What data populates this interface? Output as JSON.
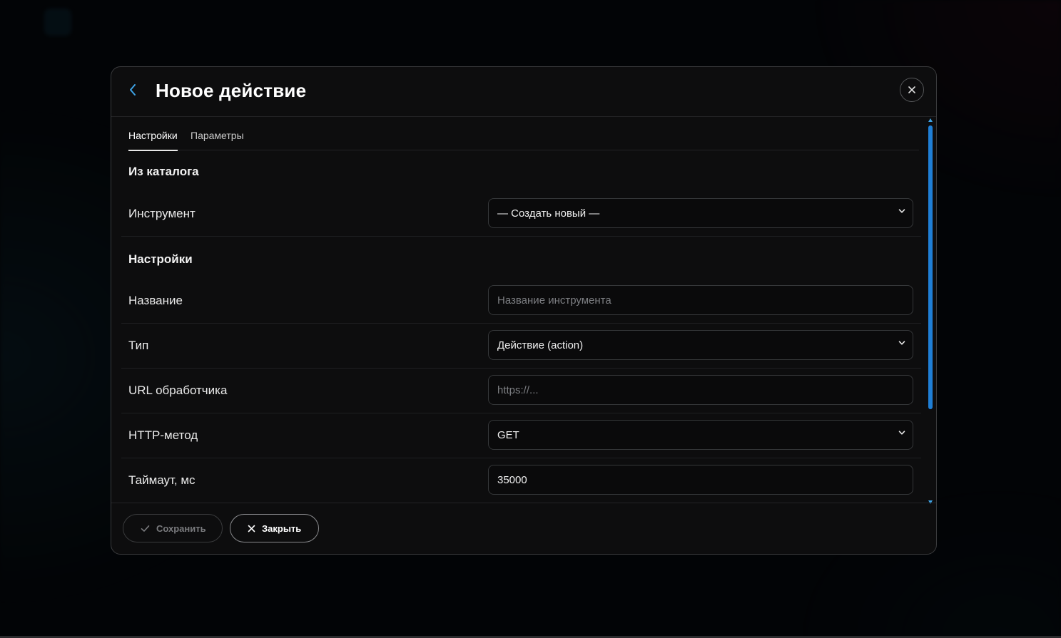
{
  "modal": {
    "title": "Новое действие",
    "tabs": [
      {
        "label": "Настройки",
        "active": true
      },
      {
        "label": "Параметры",
        "active": false
      }
    ],
    "sections": {
      "catalog": "Из каталога",
      "settings": "Настройки"
    },
    "fields": {
      "tool": {
        "label": "Инструмент",
        "value": "— Создать новый —"
      },
      "name": {
        "label": "Название",
        "placeholder": "Название инструмента"
      },
      "type": {
        "label": "Тип",
        "value": "Действие (action)"
      },
      "url": {
        "label": "URL обработчика",
        "placeholder": "https://..."
      },
      "method": {
        "label": "HTTP-метод",
        "value": "GET"
      },
      "timeout": {
        "label": "Таймаут, мс",
        "value": "35000"
      }
    },
    "footer": {
      "save_label": "Сохранить",
      "close_label": "Закрыть"
    }
  },
  "colors": {
    "accent": "#3ea3e6",
    "scrollbar": "#1f7fd6",
    "modal_bg": "#0d0d0e"
  },
  "icons": {
    "back": "chevron-left-icon",
    "close": "close-icon",
    "save": "check-icon",
    "dismiss": "close-icon",
    "select": "chevron-down-icon"
  }
}
